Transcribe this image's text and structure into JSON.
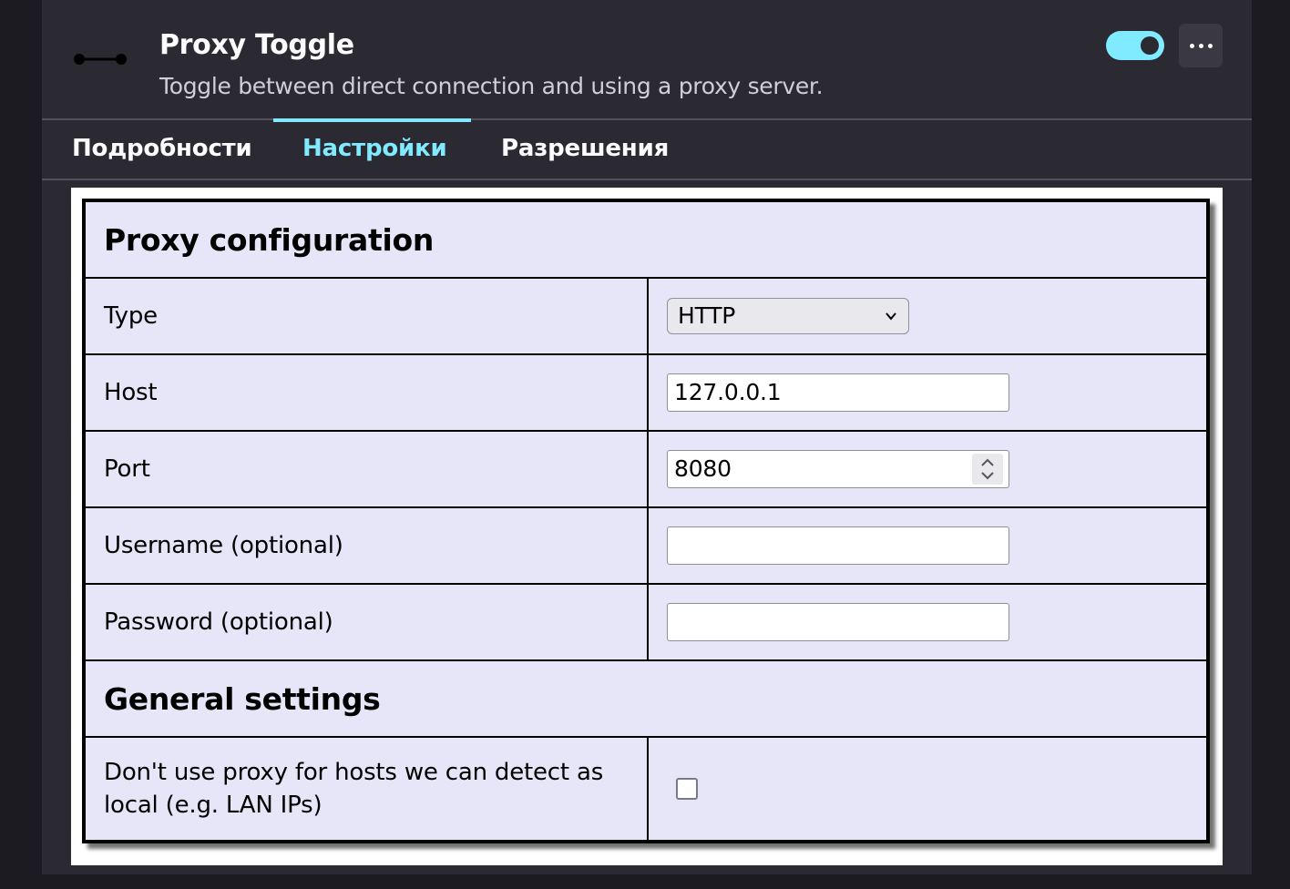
{
  "header": {
    "title": "Proxy Toggle",
    "description": "Toggle between direct connection and using a proxy server.",
    "enabled": true,
    "icon": "proxy-icon",
    "more_icon": "ellipsis-icon"
  },
  "tabs": [
    {
      "label": "Подробности",
      "active": false
    },
    {
      "label": "Настройки",
      "active": true
    },
    {
      "label": "Разрешения",
      "active": false
    }
  ],
  "proxy_config": {
    "heading": "Proxy configuration",
    "type_label": "Type",
    "type_value": "HTTP",
    "host_label": "Host",
    "host_value": "127.0.0.1",
    "port_label": "Port",
    "port_value": "8080",
    "username_label": "Username (optional)",
    "username_value": "",
    "password_label": "Password (optional)",
    "password_value": ""
  },
  "general_settings": {
    "heading": "General settings",
    "local_bypass_label": "Don't use proxy for hosts we can detect as local (e.g. LAN IPs)",
    "local_bypass_checked": false
  },
  "colors": {
    "accent": "#80ebff",
    "card_bg": "#2b2a33",
    "page_bg": "#1c1b22",
    "table_bg": "#e6e6f8"
  }
}
